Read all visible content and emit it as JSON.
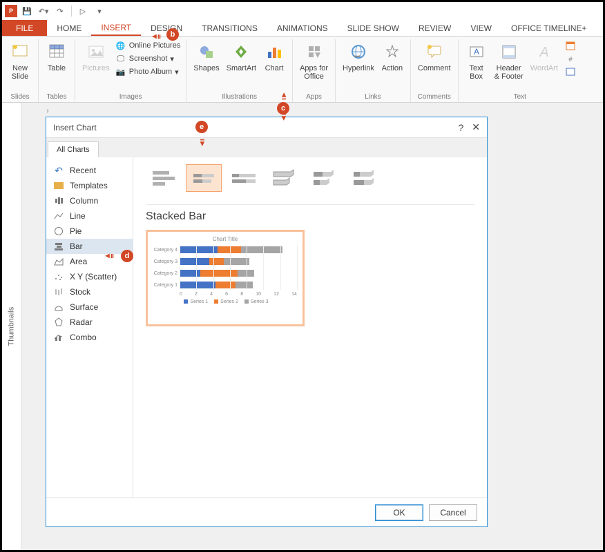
{
  "qat": {
    "save": "💾"
  },
  "tabs": {
    "file": "FILE",
    "home": "HOME",
    "insert": "INSERT",
    "design": "DESIGN",
    "transitions": "TRANSITIONS",
    "animations": "ANIMATIONS",
    "slideshow": "SLIDE SHOW",
    "review": "REVIEW",
    "view": "VIEW",
    "timeline": "OFFICE TIMELINE+"
  },
  "ribbon": {
    "slides": {
      "new_slide": "New\nSlide",
      "label": "Slides"
    },
    "tables": {
      "table": "Table",
      "label": "Tables"
    },
    "images": {
      "pictures": "Pictures",
      "online": "Online Pictures",
      "screenshot": "Screenshot",
      "album": "Photo Album",
      "label": "Images"
    },
    "illustrations": {
      "shapes": "Shapes",
      "smartart": "SmartArt",
      "chart": "Chart",
      "label": "Illustrations"
    },
    "apps": {
      "apps": "Apps for\nOffice",
      "label": "Apps"
    },
    "links": {
      "hyperlink": "Hyperlink",
      "action": "Action",
      "label": "Links"
    },
    "comments": {
      "comment": "Comment",
      "label": "Comments"
    },
    "text": {
      "textbox": "Text\nBox",
      "header": "Header\n& Footer",
      "wordart": "WordArt",
      "label": "Text"
    }
  },
  "thumbs": {
    "label": "Thumbnails"
  },
  "dialog": {
    "title": "Insert Chart",
    "tab": "All Charts",
    "cats": [
      "Recent",
      "Templates",
      "Column",
      "Line",
      "Pie",
      "Bar",
      "Area",
      "X Y (Scatter)",
      "Stock",
      "Surface",
      "Radar",
      "Combo"
    ],
    "heading": "Stacked Bar",
    "ok": "OK",
    "cancel": "Cancel",
    "help": "?",
    "close": "✕"
  },
  "callouts": {
    "b": "b",
    "c": "c",
    "d": "d",
    "e": "e"
  },
  "chart_data": {
    "type": "bar",
    "title": "Chart Title",
    "categories": [
      "Category 4",
      "Category 3",
      "Category 2",
      "Category 1"
    ],
    "series": [
      {
        "name": "Series 1",
        "values": [
          4.5,
          3.5,
          2.5,
          4.3
        ],
        "color": "#4472c4"
      },
      {
        "name": "Series 2",
        "values": [
          2.8,
          1.8,
          4.4,
          2.4
        ],
        "color": "#ed7d31"
      },
      {
        "name": "Series 3",
        "values": [
          5.0,
          3.0,
          2.0,
          2.0
        ],
        "color": "#a5a5a5"
      }
    ],
    "xlim": [
      0,
      14
    ],
    "xticks": [
      0,
      2,
      4,
      6,
      8,
      10,
      12,
      14
    ]
  }
}
